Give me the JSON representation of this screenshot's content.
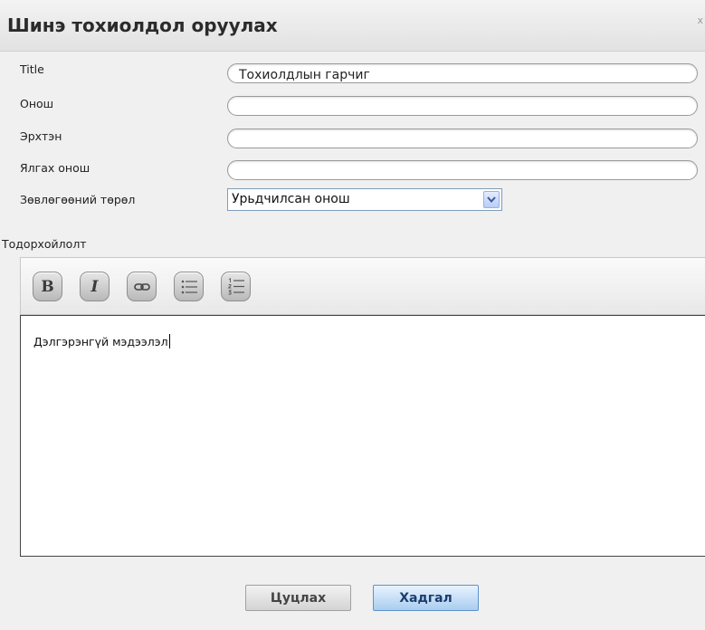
{
  "dialog": {
    "title": "Шинэ тохиолдол оруулах",
    "close_label": "x"
  },
  "form": {
    "title_label": "Title",
    "title_value": "Тохиолдлын гарчиг",
    "diagnosis_label": "Онош",
    "diagnosis_value": "",
    "organ_label": "Эрхтэн",
    "organ_value": "",
    "differential_label": "Ялгах онош",
    "differential_value": "",
    "advice_type_label": "Зөвлөгөөний төрөл",
    "advice_type_selected": "Урьдчилсан онош"
  },
  "description": {
    "label": "Тодорхойлолт",
    "text": "Дэлгэрэнгүй мэдээлэл",
    "toolbar": {
      "bold_glyph": "B",
      "italic_glyph": "I",
      "icons": [
        "bold-icon",
        "italic-icon",
        "link-icon",
        "bullet-list-icon",
        "numbered-list-icon"
      ]
    }
  },
  "buttons": {
    "clear_label": "Цуцлах",
    "save_label": "Хадгал"
  },
  "colors": {
    "save_accent": "#a9cdf0",
    "background": "#f0f0f0"
  }
}
